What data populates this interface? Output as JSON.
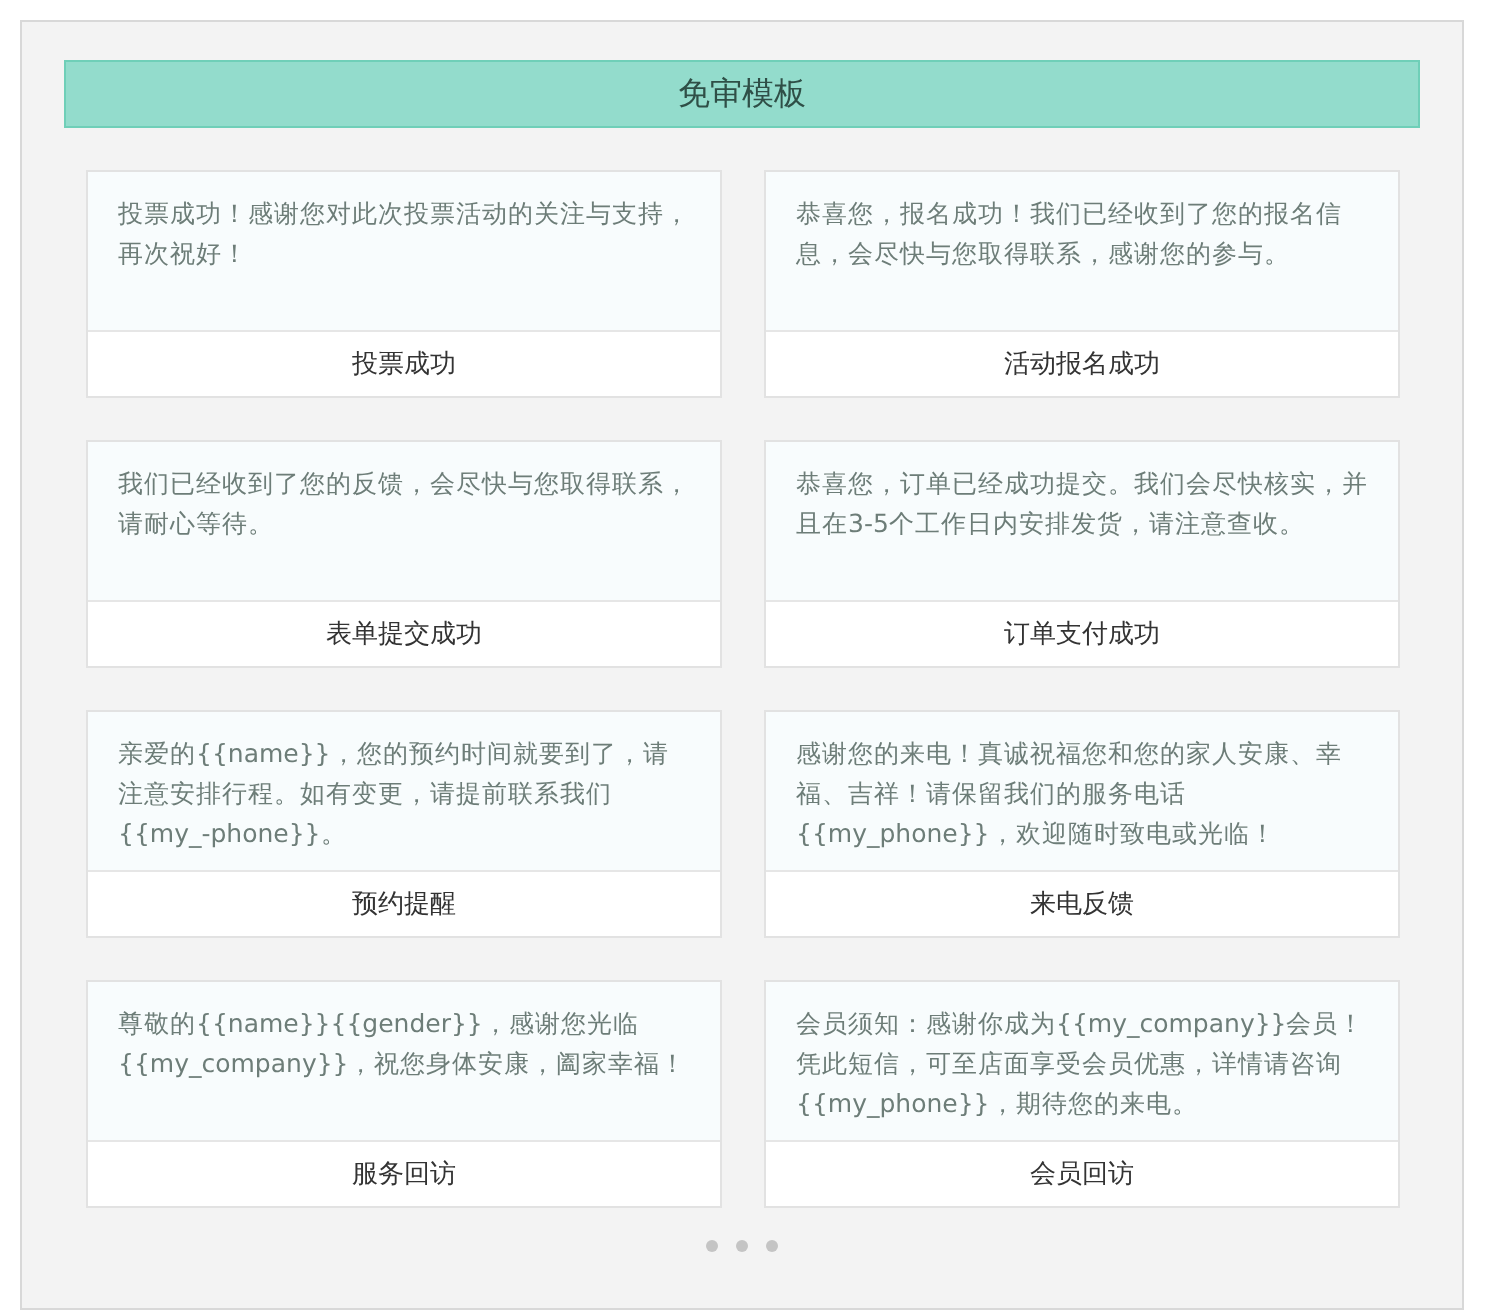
{
  "header": {
    "title": "免审模板"
  },
  "templates": [
    {
      "message": "投票成功！感谢您对此次投票活动的关注与支持，再次祝好！",
      "name": "投票成功"
    },
    {
      "message": "恭喜您，报名成功！我们已经收到了您的报名信息，会尽快与您取得联系，感谢您的参与。",
      "name": "活动报名成功"
    },
    {
      "message": "我们已经收到了您的反馈，会尽快与您取得联系，请耐心等待。",
      "name": "表单提交成功"
    },
    {
      "message": "恭喜您，订单已经成功提交。我们会尽快核实，并且在3-5个工作日内安排发货，请注意查收。",
      "name": "订单支付成功"
    },
    {
      "message": "亲爱的{{name}}，您的预约时间就要到了，请注意安排行程。如有变更，请提前联系我们{{my_-phone}}。",
      "name": "预约提醒"
    },
    {
      "message": "感谢您的来电！真诚祝福您和您的家人安康、幸福、吉祥！请保留我们的服务电话{{my_phone}}，欢迎随时致电或光临！",
      "name": "来电反馈"
    },
    {
      "message": "尊敬的{{name}}{{gender}}，感谢您光临{{my_company}}，祝您身体安康，阖家幸福！",
      "name": "服务回访"
    },
    {
      "message": "会员须知：感谢你成为{{my_company}}会员！凭此短信，可至店面享受会员优惠，详情请咨询{{my_phone}}，期待您的来电。",
      "name": "会员回访"
    }
  ]
}
